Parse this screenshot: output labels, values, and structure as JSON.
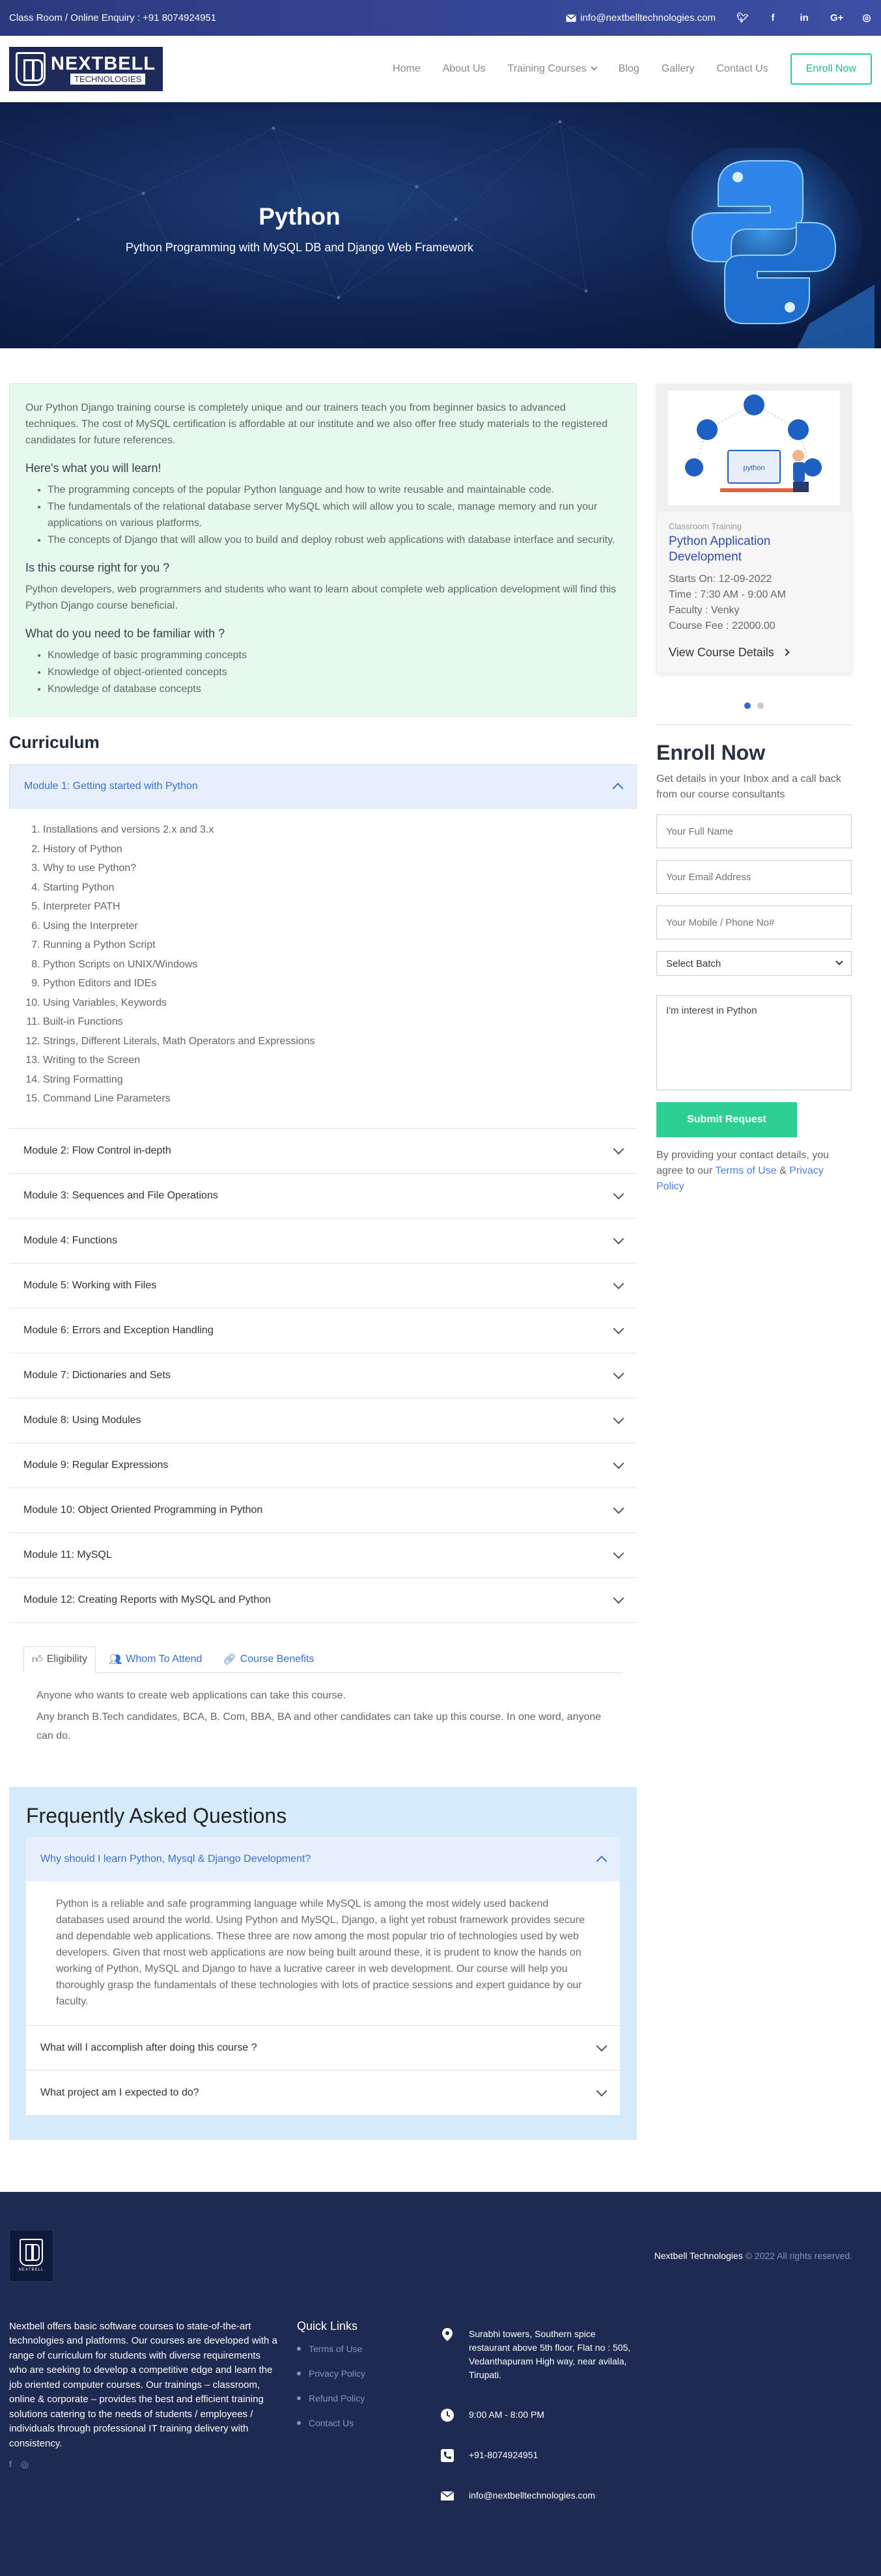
{
  "topbar": {
    "enquiry": "Class Room / Online Enquiry : +91 8074924951",
    "email": "info@nextbelltechnologies.com",
    "social_icons": [
      "twitter-icon",
      "facebook-icon",
      "linkedin-icon",
      "google-plus-icon",
      "instagram-icon"
    ]
  },
  "header": {
    "logo_text": "NEXTBELL",
    "logo_sub": "TECHNOLOGIES",
    "nav": [
      "Home",
      "About Us",
      "Training Courses",
      "Blog",
      "Gallery",
      "Contact Us"
    ],
    "enroll_button": "Enroll Now"
  },
  "hero": {
    "title": "Python",
    "subtitle": "Python Programming with MySQL DB and Django Web Framework"
  },
  "intro": {
    "paragraph": "Our Python Django training course is completely unique and our trainers teach you from beginner basics to advanced techniques. The cost of MySQL certification is affordable at our institute and we also offer free study materials to the registered candidates for future references.",
    "learn_heading": "Here's what you will learn!",
    "learn_items": [
      "The programming concepts of the popular Python language and how to write reusable and maintainable code.",
      "The fundamentals of the relational database server MySQL which will allow you to scale, manage memory and run your applications on various platforms.",
      "The concepts of Django that will allow you to build and deploy robust web applications with database interface and security."
    ],
    "right_heading": "Is this course right for you ?",
    "right_text": "Python developers, web programmers and students who want to learn about complete web application development will find this Python Django course beneficial.",
    "familiar_heading": "What do you need to be familiar with ?",
    "familiar_items": [
      "Knowledge of basic programming concepts",
      "Knowledge of object-oriented concepts",
      "Knowledge of database concepts"
    ]
  },
  "curriculum": {
    "title": "Curriculum",
    "modules": [
      "Module 1: Getting started with Python",
      "Module 2: Flow Control in-depth",
      "Module 3: Sequences and File Operations",
      "Module 4: Functions",
      "Module 5: Working with Files",
      "Module 6: Errors and Exception Handling",
      "Module 7: Dictionaries and Sets",
      "Module 8: Using Modules",
      "Module 9: Regular Expressions",
      "Module 10: Object Oriented Programming in Python",
      "Module 11: MySQL",
      "Module 12: Creating Reports with MySQL and Python"
    ],
    "module1_topics": [
      "Installations and versions 2.x and 3.x",
      "History of Python",
      "Why to use Python?",
      "Starting Python",
      "Interpreter PATH",
      "Using the Interpreter",
      "Running a Python Script",
      "Python Scripts on UNIX/Windows",
      "Python Editors and IDEs",
      "Using Variables, Keywords",
      "Built-in Functions",
      "Strings, Different Literals, Math Operators and Expressions",
      "Writing to the Screen",
      "String Formatting",
      "Command Line Parameters"
    ]
  },
  "tabs": {
    "items": [
      "Eligibility",
      "Whom To Attend",
      "Course Benefits"
    ],
    "eligibility_1": "Anyone who wants to create web applications can take this course.",
    "eligibility_2": "Any branch B.Tech candidates, BCA, B. Com, BBA, BA and other candidates can take up this course. In one word, anyone can do."
  },
  "faq": {
    "title": "Frequently Asked Questions",
    "q1": "Why should I learn Python, Mysql & Django Development?",
    "a1": "Python is a reliable and safe programming language while MySQL is among the most widely used backend databases used around the world. Using Python and MySQL, Django, a light yet robust framework provides secure and dependable web applications. These three are now among the most popular trio of technologies used by web developers. Given that most web applications are now being built around these, it is prudent to know the hands on working of Python, MySQL and Django to have a lucrative career in web development. Our course will help you thoroughly grasp the fundamentals of these technologies with lots of practice sessions and expert guidance by our faculty.",
    "q2": "What will I accomplish after doing this course ?",
    "q3": "What project am I expected to do?"
  },
  "course_card": {
    "category": "Classroom Training",
    "name": "Python Application Development",
    "starts": "Starts On: 12-09-2022",
    "time": "Time : 7:30 AM - 9:00 AM",
    "faculty": "Faculty : Venky",
    "fee": "Course Fee : 22000.00",
    "details_link": "View Course Details",
    "image_text": "python"
  },
  "enroll": {
    "title": "Enroll Now",
    "text": "Get details in your Inbox and a call back from our course consultants",
    "name_placeholder": "Your Full Name",
    "email_placeholder": "Your Email Address",
    "phone_placeholder": "Your Mobile / Phone No#",
    "batch_select": "Select Batch",
    "message": "I'm interest in Python",
    "submit": "Submit Request",
    "agree_pre": "By providing your contact details, you agree to our",
    "terms": "Terms of Use",
    "amp": "&",
    "privacy": "Privacy Policy"
  },
  "footer": {
    "company": "Nextbell Technologies",
    "copyright": "© 2022 All rights reserved.",
    "logo_caption": "NEXTBELL",
    "about": "Nextbell offers basic software courses to state-of-the-art technologies and platforms. Our courses are developed with a range of curriculum for students with diverse requirements who are seeking to develop a competitive edge and learn the job oriented computer courses. Our trainings – classroom, online & corporate – provides the best and efficient training solutions catering to the needs of students / employees / individuals through professional IT training delivery with consistency.",
    "social": [
      "f",
      "◎"
    ],
    "quick_links_title": "Quick Links",
    "quick_links": [
      "Terms of Use",
      "Privacy Policy",
      "Refund Policy",
      "Contact Us"
    ],
    "address": "Surabhi towers, Southern spice restaurant above 5th floor, Flat no : 505, Vedanthapuram High way, near avilala, Tirupati.",
    "hours": "9:00 AM - 8:00 PM",
    "phone": "+91-8074924951",
    "email": "info@nextbelltechnologies.com"
  },
  "colors": {
    "brand_blue": "#2c3a7e",
    "accent_green": "#2fcf94",
    "link_blue": "#3a6fd1"
  }
}
